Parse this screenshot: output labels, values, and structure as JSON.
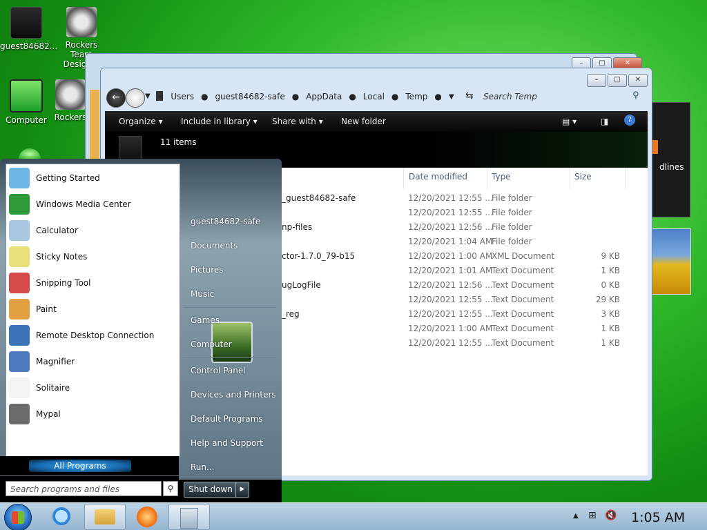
{
  "desktop": {
    "icons": [
      {
        "label": "guest84682...",
        "name": "user-folder"
      },
      {
        "label": "Rockers Team Design S",
        "name": "rockers-team-design"
      },
      {
        "label": "Computer",
        "name": "computer"
      },
      {
        "label": "Rockers",
        "name": "rockers"
      }
    ],
    "gadget_text": "dlines"
  },
  "explorer": {
    "breadcrumb": [
      "Users",
      "guest84682-safe",
      "AppData",
      "Local",
      "Temp"
    ],
    "search_placeholder": "Search Temp",
    "toolbar": {
      "organize": "Organize",
      "include": "Include in library",
      "share": "Share with",
      "new_folder": "New folder"
    },
    "item_count": "11 items",
    "columns": {
      "date": "Date modified",
      "type": "Type",
      "size": "Size"
    },
    "rows": [
      {
        "name": "_guest84682-safe",
        "date": "12/20/2021 12:55 ...",
        "type": "File folder",
        "size": ""
      },
      {
        "name": "",
        "date": "12/20/2021 12:55 ...",
        "type": "File folder",
        "size": ""
      },
      {
        "name": "np-files",
        "date": "12/20/2021 12:56 ...",
        "type": "File folder",
        "size": ""
      },
      {
        "name": "",
        "date": "12/20/2021 1:04 AM",
        "type": "File folder",
        "size": ""
      },
      {
        "name": "ctor-1.7.0_79-b15",
        "date": "12/20/2021 1:00 AM",
        "type": "XML Document",
        "size": "9 KB"
      },
      {
        "name": "",
        "date": "12/20/2021 1:01 AM",
        "type": "Text Document",
        "size": "1 KB"
      },
      {
        "name": "ugLogFile",
        "date": "12/20/2021 12:56 ...",
        "type": "Text Document",
        "size": "0 KB"
      },
      {
        "name": "",
        "date": "12/20/2021 12:55 ...",
        "type": "Text Document",
        "size": "29 KB"
      },
      {
        "name": "_reg",
        "date": "12/20/2021 12:55 ...",
        "type": "Text Document",
        "size": "3 KB"
      },
      {
        "name": "",
        "date": "12/20/2021 1:00 AM",
        "type": "Text Document",
        "size": "1 KB"
      },
      {
        "name": "",
        "date": "12/20/2021 12:55 ...",
        "type": "Text Document",
        "size": "1 KB"
      }
    ]
  },
  "start_menu": {
    "programs": [
      {
        "label": "Getting Started",
        "icon": "getting-started-icon",
        "color": "#6fb7e6"
      },
      {
        "label": "Windows Media Center",
        "icon": "media-center-icon",
        "color": "#2e9a3a"
      },
      {
        "label": "Calculator",
        "icon": "calculator-icon",
        "color": "#a9c6e0"
      },
      {
        "label": "Sticky Notes",
        "icon": "sticky-notes-icon",
        "color": "#e8e07a"
      },
      {
        "label": "Snipping Tool",
        "icon": "snipping-tool-icon",
        "color": "#d54a4a"
      },
      {
        "label": "Paint",
        "icon": "paint-icon",
        "color": "#e3a040"
      },
      {
        "label": "Remote Desktop Connection",
        "icon": "remote-desktop-icon",
        "color": "#3a73b8"
      },
      {
        "label": "Magnifier",
        "icon": "magnifier-icon",
        "color": "#4c7bbf"
      },
      {
        "label": "Solitaire",
        "icon": "solitaire-icon",
        "color": "#f3f3f3"
      },
      {
        "label": "Mypal",
        "icon": "mypal-icon",
        "color": "#6b6b6b"
      }
    ],
    "all_programs": "All Programs",
    "search_placeholder": "Search programs and files",
    "right": {
      "user": "guest84682-safe",
      "documents": "Documents",
      "pictures": "Pictures",
      "music": "Music",
      "games": "Games",
      "computer": "Computer",
      "control_panel": "Control Panel",
      "devices": "Devices and Printers",
      "default_programs": "Default Programs",
      "help": "Help and Support",
      "run": "Run..."
    },
    "shutdown": "Shut down"
  },
  "taskbar": {
    "clock": "1:05 AM"
  }
}
